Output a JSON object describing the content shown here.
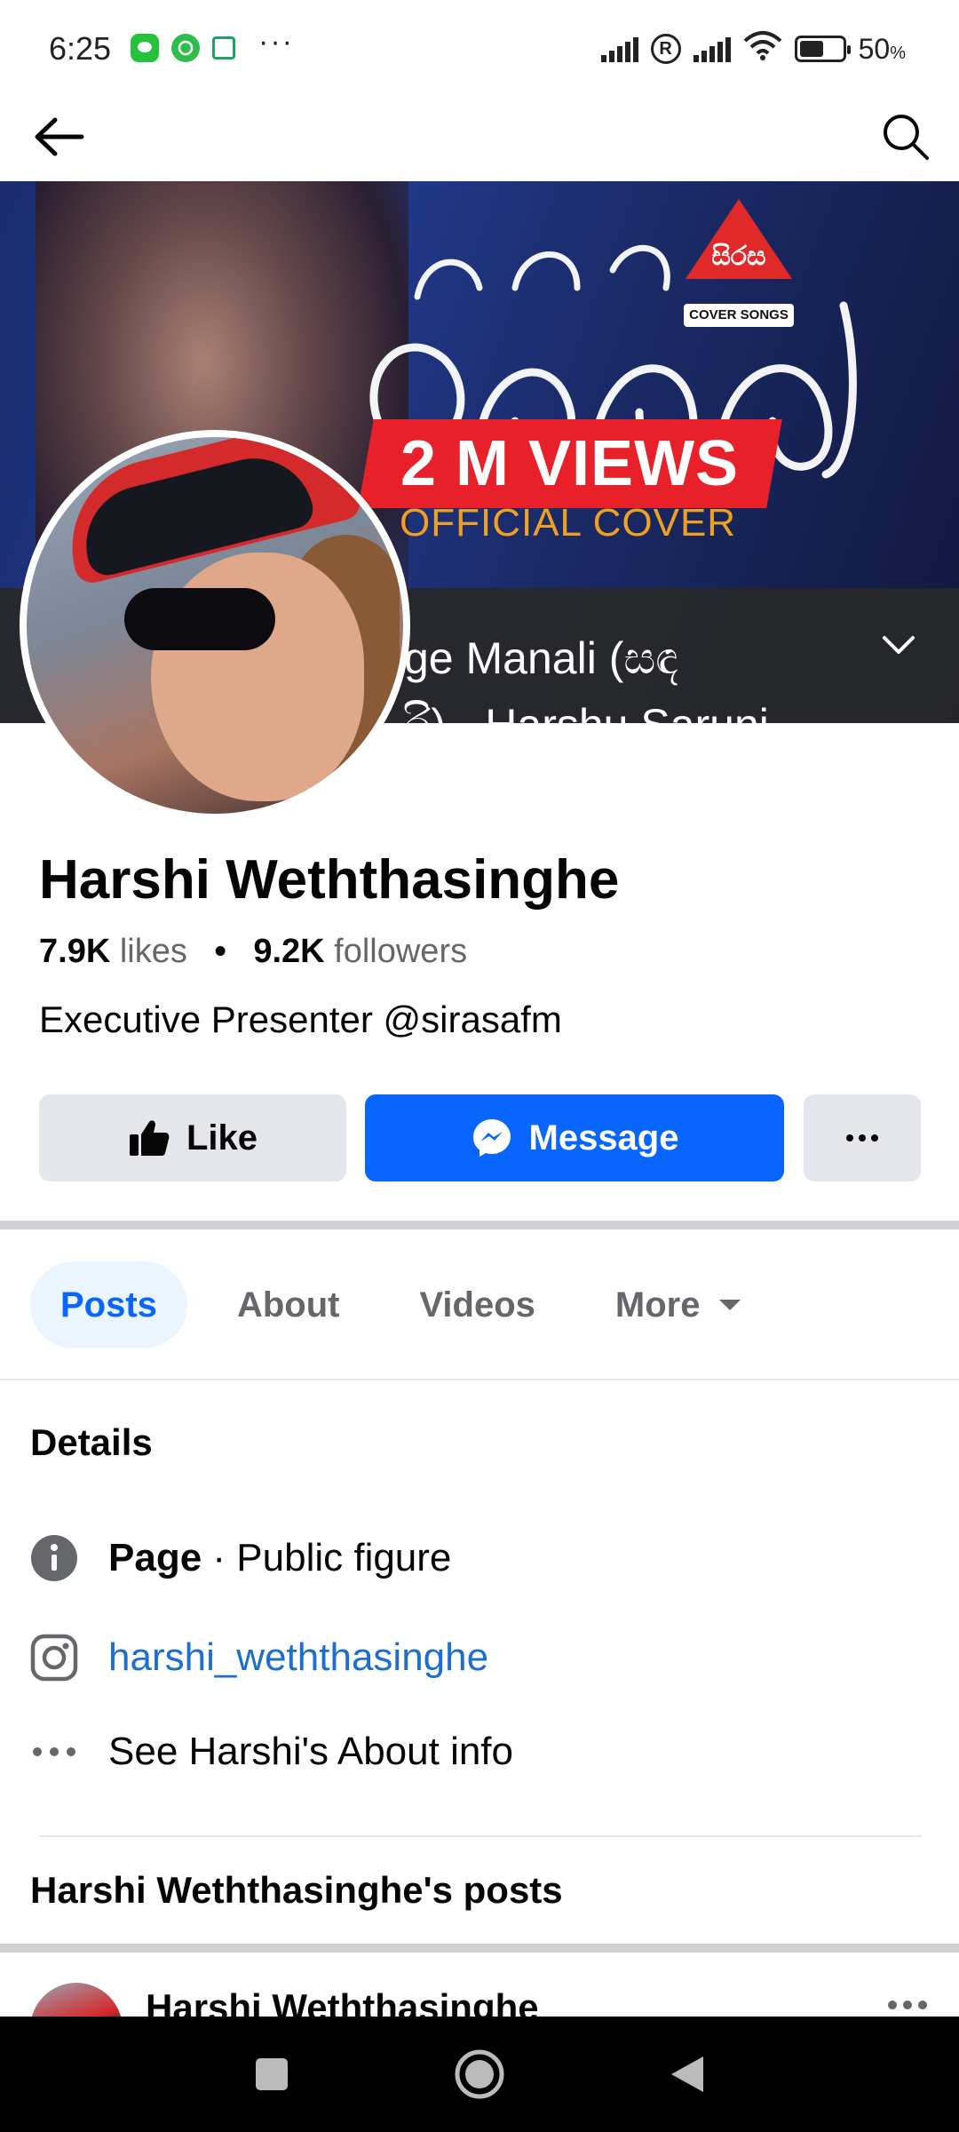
{
  "status_bar": {
    "time": "6:25",
    "battery_text": "50",
    "battery_unit": "%",
    "battery_level": 0.5,
    "icons": [
      "message-app-icon",
      "whatsapp-icon",
      "classroom-icon",
      "more-dots-icon",
      "signal-icon",
      "roaming-icon",
      "signal-icon",
      "wifi-icon",
      "battery-icon"
    ]
  },
  "app_bar": {
    "back_icon": "arrow-left-icon",
    "search_icon": "search-icon"
  },
  "cover": {
    "script_text": "සඳ කුමාරි මගෙ මනාලි",
    "logo_text": "සිරස",
    "logo_sub": "COVER SONGS",
    "views_banner": "2 M VIEWS",
    "official": "OFFICIAL COVER",
    "caption_line1": "ge Manali (සඳ",
    "caption_line2": "රි) - Harshu Saruni"
  },
  "profile": {
    "name": "Harshi Weththasinghe",
    "likes_value": "7.9K",
    "likes_label": "likes",
    "followers_value": "9.2K",
    "followers_label": "followers",
    "bio": "Executive Presenter @sirasafm"
  },
  "actions": {
    "like_label": "Like",
    "message_label": "Message"
  },
  "tabs": [
    {
      "label": "Posts",
      "active": true
    },
    {
      "label": "About",
      "active": false
    },
    {
      "label": "Videos",
      "active": false
    },
    {
      "label": "More",
      "active": false
    }
  ],
  "details": {
    "title": "Details",
    "page_label": "Page",
    "page_category": " · Public figure",
    "instagram": "harshi_weththasinghe",
    "see_about": "See Harshi's About info"
  },
  "posts": {
    "title": "Harshi Weththasinghe's posts",
    "first_post_author": "Harshi Weththasinghe"
  },
  "colors": {
    "accent": "#0866ff",
    "link": "#1c6fd0",
    "button_bg": "#e4e6eb",
    "tab_active_bg": "#ebf5ff",
    "secondary_text": "#65676b"
  }
}
